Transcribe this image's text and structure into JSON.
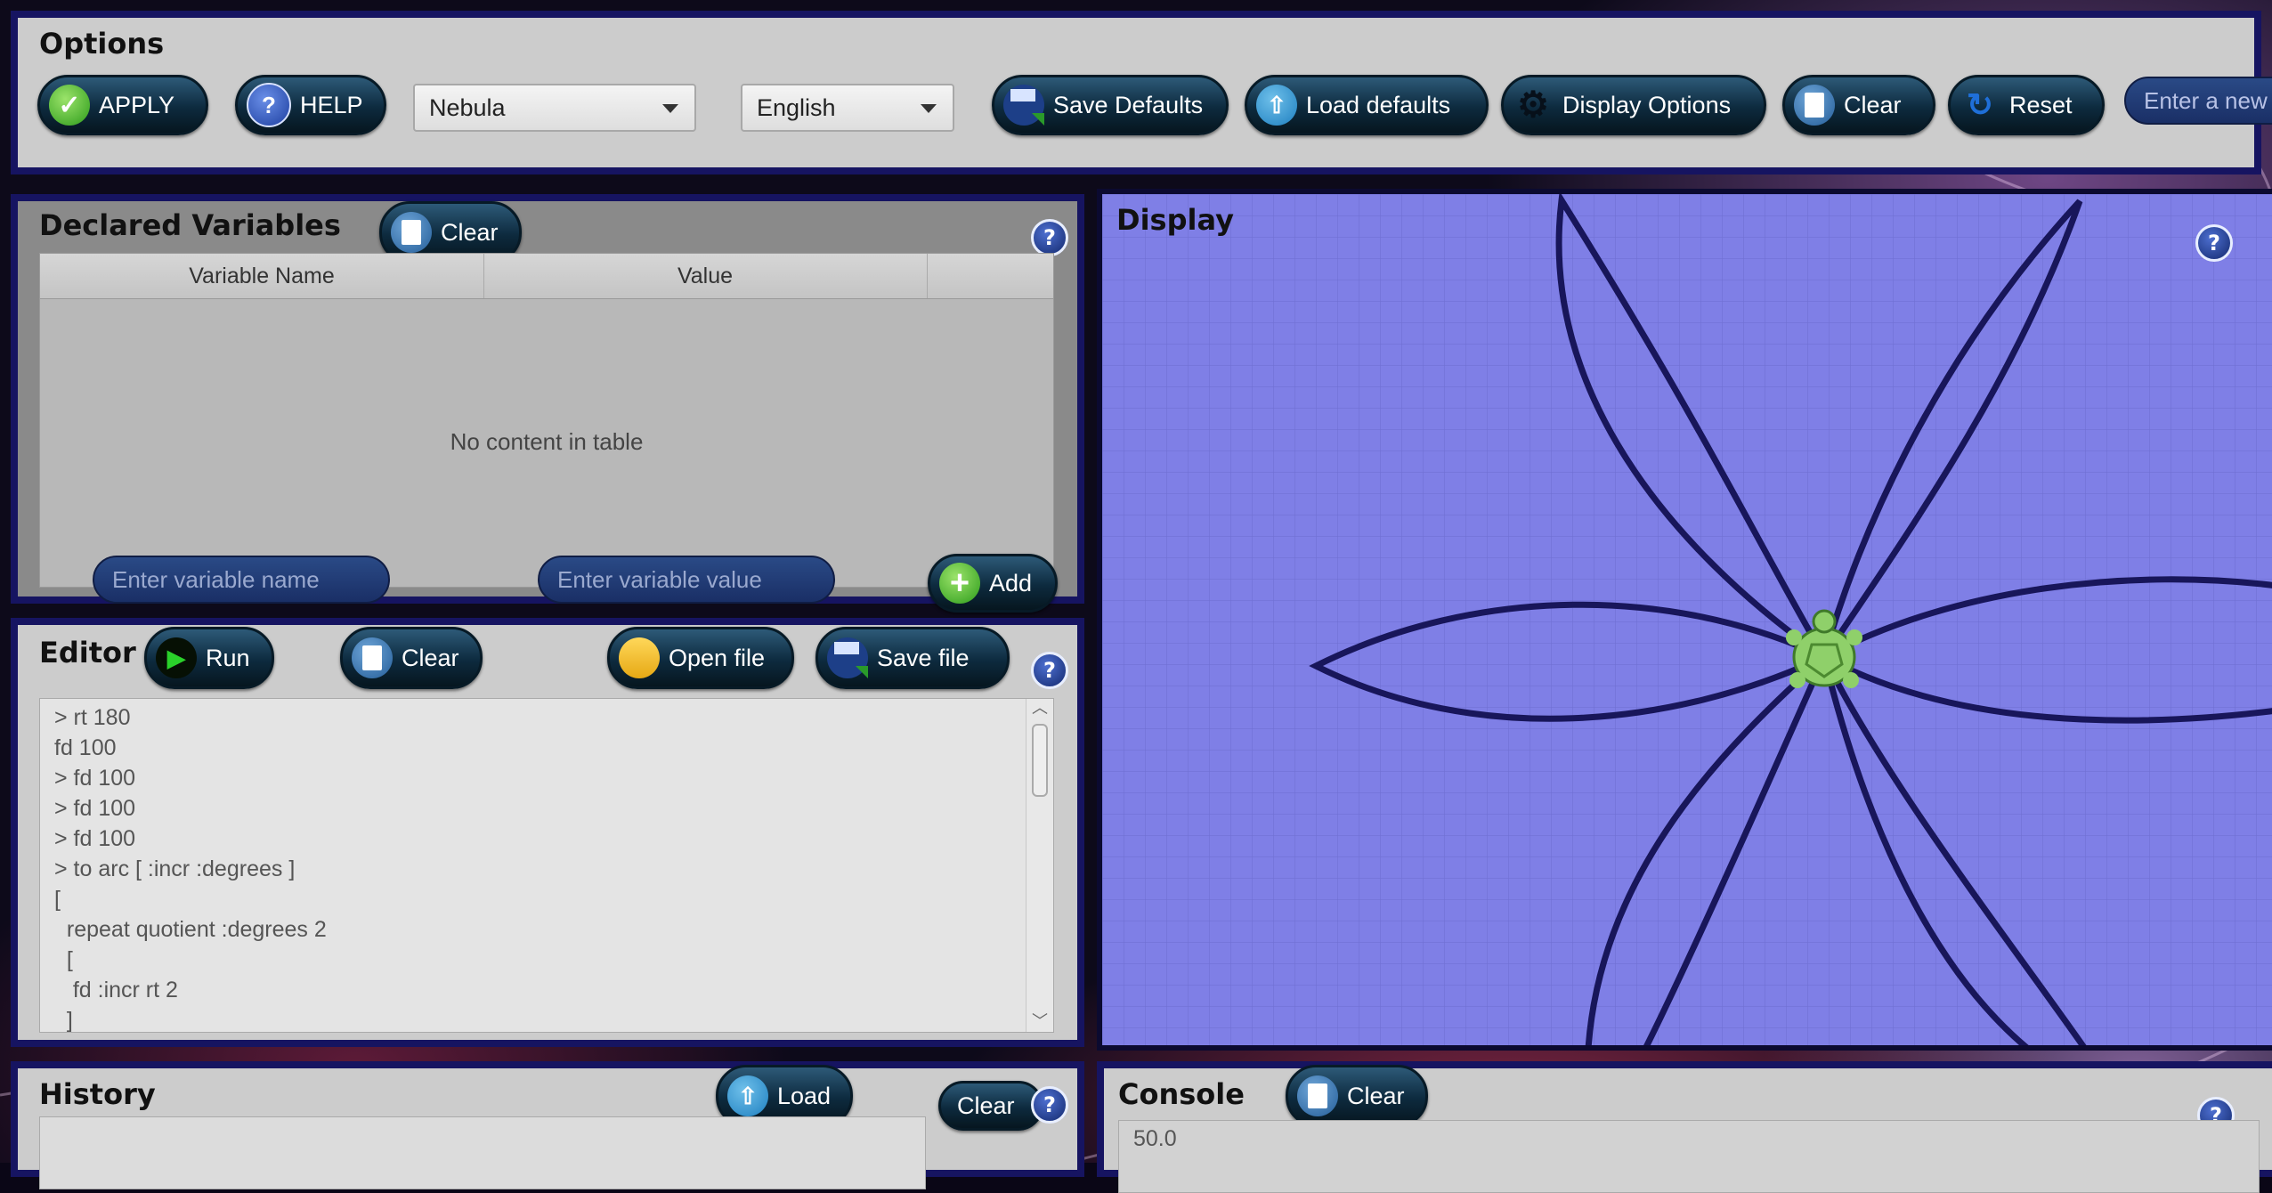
{
  "options": {
    "title": "Options",
    "apply_label": "APPLY",
    "help_label": "HELP",
    "theme_value": "Nebula",
    "language_value": "English",
    "save_defaults_label": "Save Defaults",
    "load_defaults_label": "Load defaults",
    "display_options_label": "Display Options",
    "clear_label": "Clear",
    "reset_label": "Reset",
    "new_turtle_placeholder": "Enter a new t"
  },
  "variables": {
    "title": "Declared Variables",
    "clear_label": "Clear",
    "columns": [
      "Variable Name",
      "Value"
    ],
    "empty_text": "No content in table",
    "name_placeholder": "Enter variable name",
    "value_placeholder": "Enter variable value",
    "add_label": "Add",
    "help": "?"
  },
  "editor": {
    "title": "Editor",
    "run_label": "Run",
    "clear_label": "Clear",
    "open_label": "Open file",
    "save_label": "Save file",
    "help": "?",
    "lines": [
      "> rt 180",
      "fd 100",
      "> fd 100",
      "> fd 100",
      "> fd 100",
      "> to arc [ :incr :degrees ]",
      "[",
      "  repeat quotient :degrees 2",
      "  [",
      "   fd :incr rt 2",
      "  ]"
    ]
  },
  "display": {
    "title": "Display",
    "help": "?",
    "background_color": "#7f7fe6",
    "line_color": "#18165a"
  },
  "history": {
    "title": "History",
    "load_label": "Load",
    "clear_label": "Clear",
    "help": "?"
  },
  "console": {
    "title": "Console",
    "clear_label": "Clear",
    "help": "?",
    "value": "50.0"
  }
}
